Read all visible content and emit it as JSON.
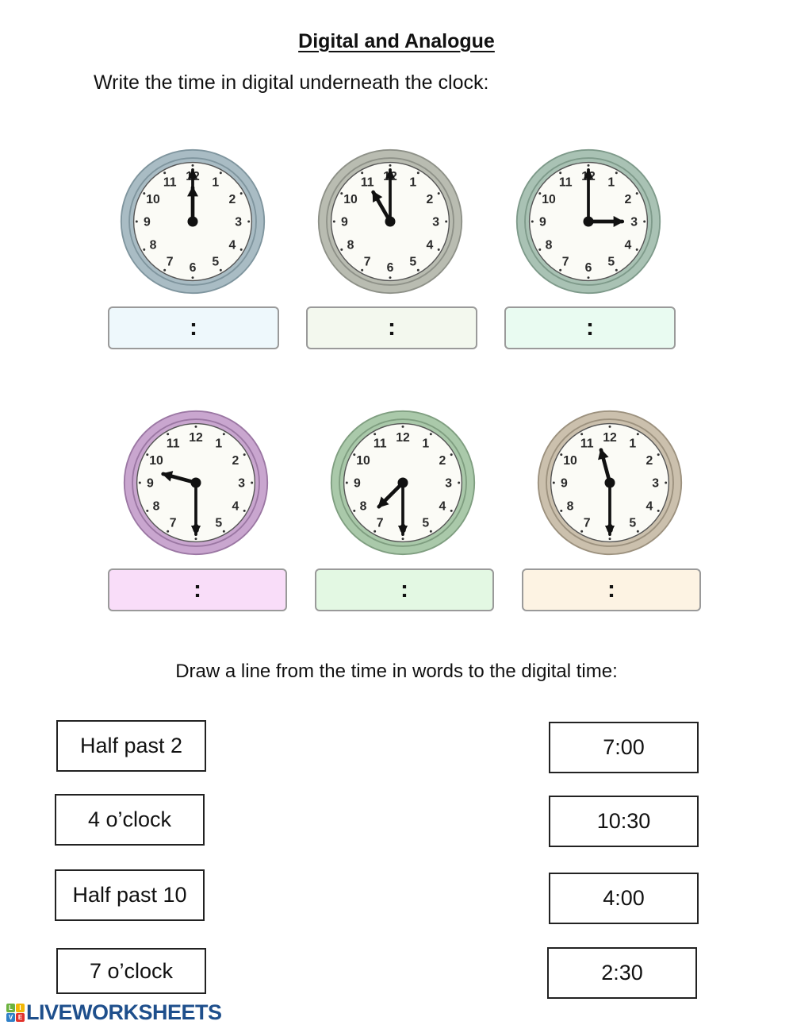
{
  "worksheet": {
    "title": "Digital and Analogue",
    "instruction_1": "Write the time in digital underneath the clock:",
    "instruction_2": "Draw a line from the time in words to the digital time:"
  },
  "clocks": [
    {
      "label": "clock-1",
      "hour": 12,
      "minute": 0,
      "bezel_color": "#a9bcc4",
      "bezel_dark": "#7f959e",
      "answer_fill": "#eef8fc",
      "answer_text": ":"
    },
    {
      "label": "clock-2",
      "hour": 11,
      "minute": 0,
      "bezel_color": "#b9bcb1",
      "bezel_dark": "#8e9188",
      "answer_fill": "#f3f8ee",
      "answer_text": ":"
    },
    {
      "label": "clock-3",
      "hour": 3,
      "minute": 0,
      "bezel_color": "#a9c2b4",
      "bezel_dark": "#7e9a8a",
      "answer_fill": "#e9fbf1",
      "answer_text": ":"
    },
    {
      "label": "clock-4",
      "hour": 9,
      "minute": 30,
      "bezel_color": "#c9a6cf",
      "bezel_dark": "#9b77a3",
      "answer_fill": "#f9ddf9",
      "answer_text": ":"
    },
    {
      "label": "clock-5",
      "hour": 7,
      "minute": 30,
      "bezel_color": "#aac9aa",
      "bezel_dark": "#7f9e80",
      "answer_fill": "#e3f8e3",
      "answer_text": ":"
    },
    {
      "label": "clock-6",
      "hour": 11,
      "minute": 30,
      "bezel_color": "#cbc0ad",
      "bezel_dark": "#9c917e",
      "answer_fill": "#fdf3e3",
      "answer_text": ":"
    }
  ],
  "clock_numerals": [
    "12",
    "1",
    "2",
    "3",
    "4",
    "5",
    "6",
    "7",
    "8",
    "9",
    "10",
    "11"
  ],
  "match_words": [
    "Half past 2",
    "4 o’clock",
    "Half past 10",
    "7 o’clock"
  ],
  "match_digital": [
    "7:00",
    "10:30",
    "4:00",
    "2:30"
  ],
  "branding": {
    "logo_text": "LIVEWORKSHEETS",
    "tiles": [
      {
        "letter": "L",
        "color": "#6cb33f"
      },
      {
        "letter": "I",
        "color": "#f2b705"
      },
      {
        "letter": "V",
        "color": "#2f80c8"
      },
      {
        "letter": "E",
        "color": "#e2322b"
      }
    ]
  }
}
